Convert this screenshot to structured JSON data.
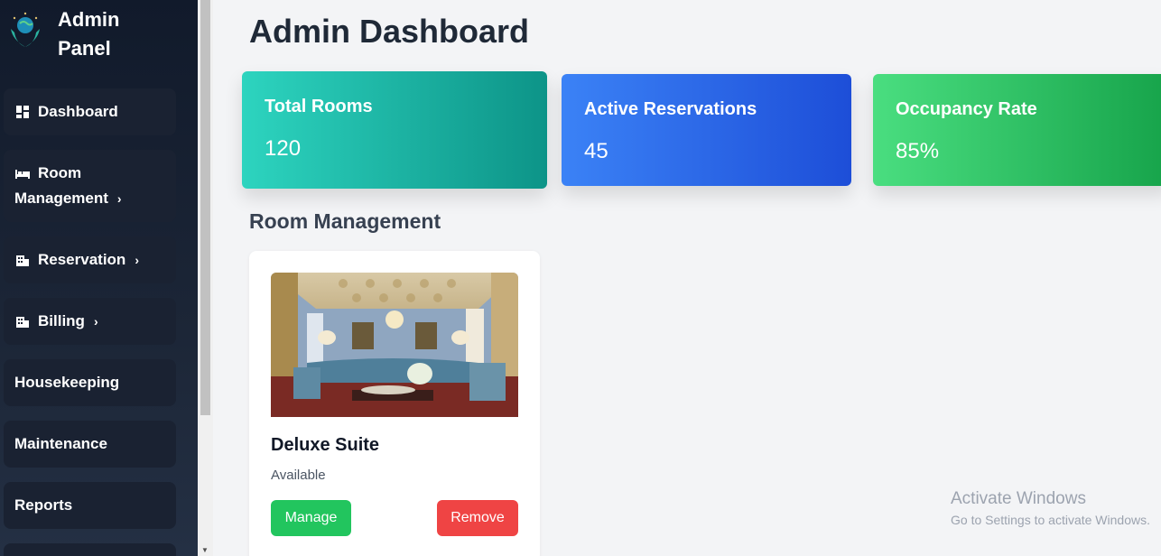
{
  "sidebar": {
    "title": "Admin Panel",
    "items": [
      {
        "label": "Dashboard",
        "icon": "grid-icon"
      },
      {
        "label_line1": "Room",
        "label_line2": "Management",
        "icon": "bed-icon"
      },
      {
        "label": "Reservation",
        "icon": "building-icon"
      },
      {
        "label": "Billing",
        "icon": "building-icon"
      },
      {
        "label": "Housekeeping"
      },
      {
        "label": "Maintenance"
      },
      {
        "label": "Reports"
      }
    ]
  },
  "main": {
    "title": "Admin Dashboard",
    "stats": [
      {
        "label": "Total Rooms",
        "value": "120",
        "color": "#14b8a6"
      },
      {
        "label": "Active Reservations",
        "value": "45",
        "color": "#2563eb"
      },
      {
        "label": "Occupancy Rate",
        "value": "85%",
        "color": "#22c55e"
      }
    ],
    "section_title": "Room Management",
    "room_card": {
      "name": "Deluxe Suite",
      "status": "Available",
      "manage_label": "Manage",
      "remove_label": "Remove"
    }
  },
  "watermark": {
    "line1": "Activate Windows",
    "line2": "Go to Settings to activate Windows."
  }
}
